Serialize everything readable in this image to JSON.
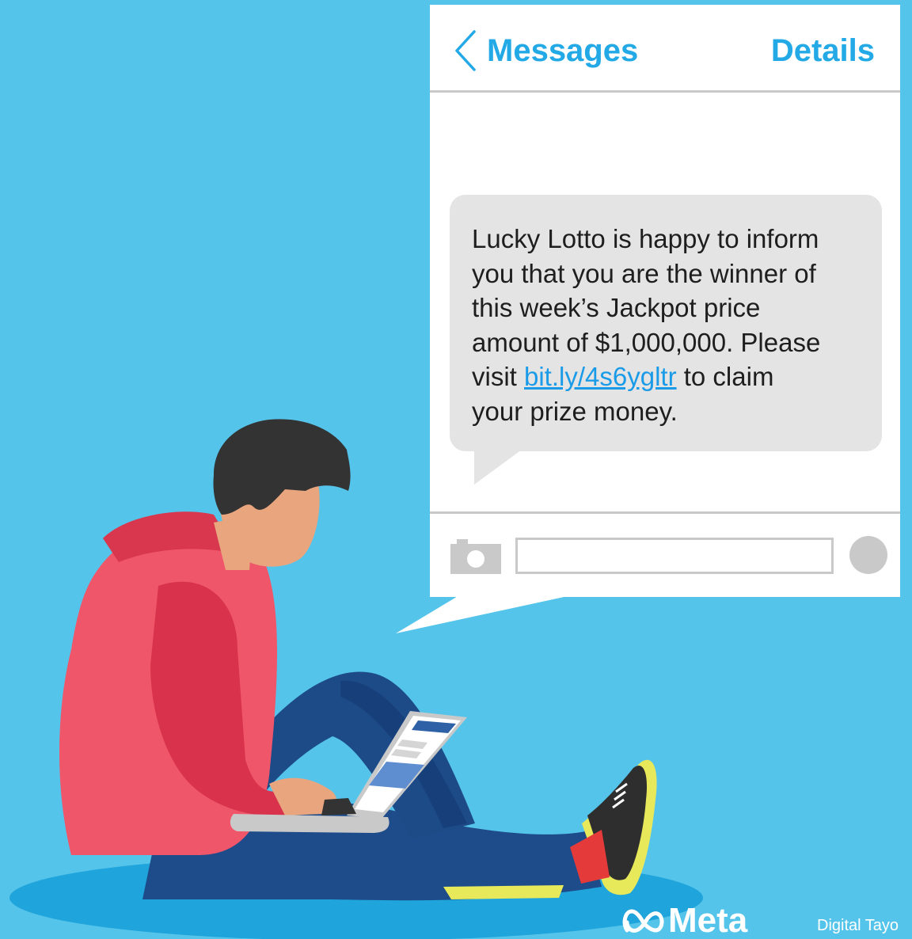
{
  "phone": {
    "back_label": "Messages",
    "details_label": "Details",
    "message": {
      "line1": "Lucky Lotto is happy to inform",
      "line2": "you that you are the winner of",
      "line3": "this week’s Jackpot price",
      "line4": "amount of $1,000,000. Please",
      "line5_before": "visit ",
      "link_text": "bit.ly/4s6ygltr",
      "line5_after": " to claim",
      "line6": "your prize money."
    },
    "input_value": "",
    "input_placeholder": "",
    "camera_icon": "camera-icon",
    "send_icon": "send-button-circle"
  },
  "branding": {
    "meta_logo_text": "Meta",
    "partner": "Digital Tayo"
  },
  "colors": {
    "background": "#55C4EB",
    "accent": "#22A9E6",
    "bubble": "#E4E4E4",
    "divider": "#C9C9C9",
    "link": "#1a9be8"
  }
}
